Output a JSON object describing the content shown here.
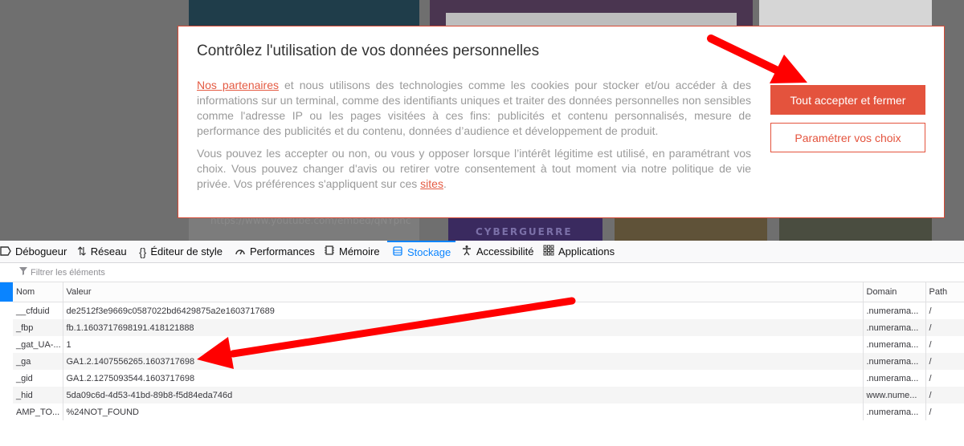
{
  "webpage": {
    "embed_url": "https://www.youtube.com/embed/qNYpnc",
    "thumbnail_caption": "CYBERGUERRE"
  },
  "consent": {
    "title": "Contrôlez l'utilisation de vos données personnelles",
    "p1_link": "Nos partenaires",
    "p1_text": " et nous utilisons des technologies comme les cookies pour stocker et/ou accéder à des informations sur un terminal, comme des identifiants uniques et traiter des données personnelles non sensibles comme l'adresse IP ou les pages visitées à ces fins: publicités et contenu personnalisés, mesure de performance des publicités et du contenu, données d’audience et développement de produit.",
    "p2_text": "Vous pouvez les accepter ou non, ou vous y opposer lorsque l’intérêt légitime est utilisé, en paramétrant vos choix. Vous pouvez changer d'avis ou retirer votre consentement à tout moment via notre politique de vie privée. Vos préférences s'appliquent sur ces ",
    "p2_link": "sites",
    "p2_end": ".",
    "accept_label": "Tout accepter et fermer",
    "settings_label": "Paramétrer vos choix",
    "accent_color": "#e4533d"
  },
  "devtools": {
    "tabs": [
      {
        "label": "Débogueur",
        "icon": "debugger-icon"
      },
      {
        "label": "Réseau",
        "icon": "network-icon"
      },
      {
        "label": "Éditeur de style",
        "icon": "braces-icon"
      },
      {
        "label": "Performances",
        "icon": "gauge-icon"
      },
      {
        "label": "Mémoire",
        "icon": "chip-icon"
      },
      {
        "label": "Stockage",
        "icon": "storage-icon",
        "active": true
      },
      {
        "label": "Accessibilité",
        "icon": "accessibility-icon"
      },
      {
        "label": "Applications",
        "icon": "grid-icon"
      }
    ],
    "filter_placeholder": "Filtrer les éléments",
    "columns": [
      "Nom",
      "Valeur",
      "Domain",
      "Path"
    ],
    "rows": [
      {
        "name": "__cfduid",
        "value": "de2512f3e9669c0587022bd6429875a2e1603717689",
        "domain": ".numerama...",
        "path": "/"
      },
      {
        "name": "_fbp",
        "value": "fb.1.1603717698191.418121888",
        "domain": ".numerama...",
        "path": "/"
      },
      {
        "name": "_gat_UA-...",
        "value": "1",
        "domain": ".numerama...",
        "path": "/"
      },
      {
        "name": "_ga",
        "value": "GA1.2.1407556265.1603717698",
        "domain": ".numerama...",
        "path": "/"
      },
      {
        "name": "_gid",
        "value": "GA1.2.1275093544.1603717698",
        "domain": ".numerama...",
        "path": "/"
      },
      {
        "name": "_hid",
        "value": "5da09c6d-4d53-41bd-89b8-f5d84eda746d",
        "domain": "www.nume...",
        "path": "/"
      },
      {
        "name": "AMP_TO...",
        "value": "%24NOT_FOUND",
        "domain": ".numerama...",
        "path": "/"
      }
    ],
    "accent_color": "#0a84ff"
  },
  "annotations": {
    "arrow_color": "#ff0000"
  }
}
